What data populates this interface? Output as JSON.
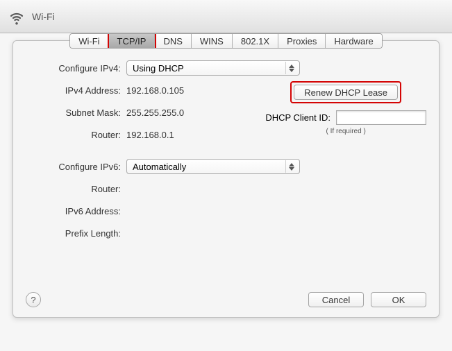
{
  "header": {
    "title": "Wi-Fi"
  },
  "tabs": {
    "items": [
      "Wi-Fi",
      "TCP/IP",
      "DNS",
      "WINS",
      "802.1X",
      "Proxies",
      "Hardware"
    ],
    "selected": "TCP/IP"
  },
  "ipv4": {
    "configure_label": "Configure IPv4:",
    "configure_value": "Using DHCP",
    "address_label": "IPv4 Address:",
    "address_value": "192.168.0.105",
    "subnet_label": "Subnet Mask:",
    "subnet_value": "255.255.255.0",
    "router_label": "Router:",
    "router_value": "192.168.0.1"
  },
  "dhcp": {
    "renew_label": "Renew DHCP Lease",
    "client_id_label": "DHCP Client ID:",
    "client_id_value": "",
    "if_required": "( If required )"
  },
  "ipv6": {
    "configure_label": "Configure IPv6:",
    "configure_value": "Automatically",
    "router_label": "Router:",
    "router_value": "",
    "address_label": "IPv6 Address:",
    "address_value": "",
    "prefix_label": "Prefix Length:",
    "prefix_value": ""
  },
  "buttons": {
    "cancel": "Cancel",
    "ok": "OK",
    "help": "?"
  }
}
